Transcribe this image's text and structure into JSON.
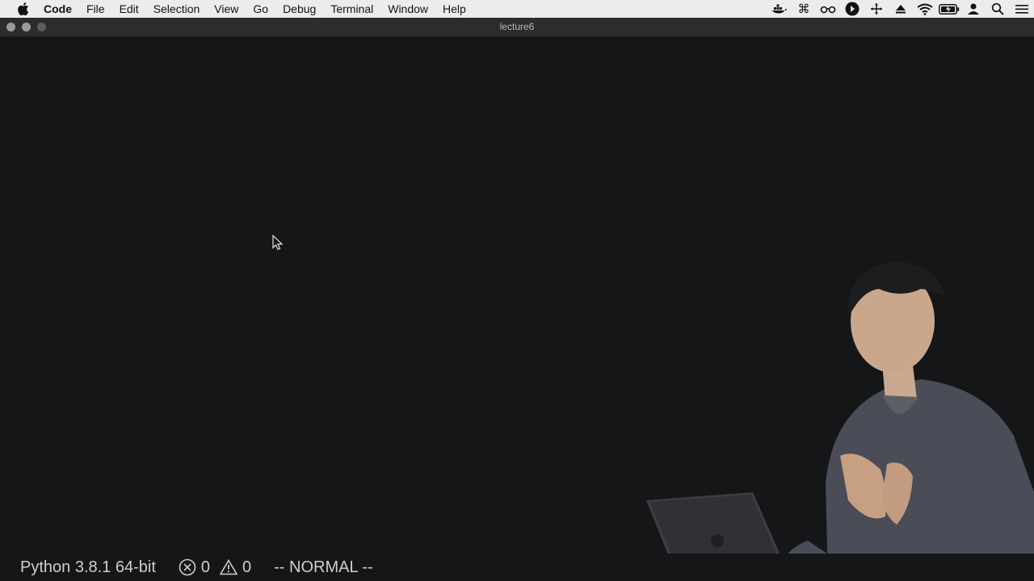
{
  "menubar": {
    "apple_icon": "apple-icon",
    "app_name": "Code",
    "items": [
      "File",
      "Edit",
      "Selection",
      "View",
      "Go",
      "Debug",
      "Terminal",
      "Window",
      "Help"
    ],
    "status_icons": [
      "docker-icon",
      "command-icon",
      "glasses-icon",
      "play-circle-icon",
      "move-icon",
      "eject-icon",
      "wifi-icon",
      "battery-icon",
      "user-icon",
      "search-icon",
      "list-icon"
    ]
  },
  "window": {
    "title": "lecture6"
  },
  "statusbar": {
    "python": "Python 3.8.1 64-bit",
    "errors": "0",
    "warnings": "0",
    "mode": "-- NORMAL --"
  }
}
